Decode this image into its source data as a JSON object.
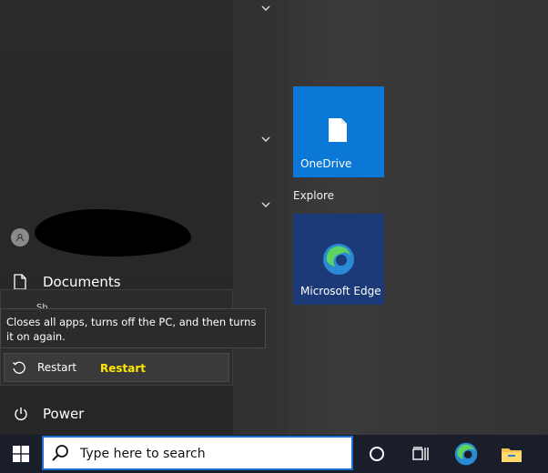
{
  "start_menu": {
    "tiles": {
      "onedrive_label": "OneDrive",
      "group_label": "Explore",
      "edge_label": "Microsoft Edge"
    },
    "user_row": {
      "avatar_icon": "user-icon"
    },
    "documents_label": "Documents",
    "peek_text": "Sh",
    "power_label": "Power",
    "power_flyout": {
      "tooltip": "Closes all apps, turns off the PC, and then turns it on again.",
      "restart_label": "Restart",
      "annotation": "Restart"
    }
  },
  "taskbar": {
    "search_placeholder": "Type here to search"
  },
  "colors": {
    "onedrive_tile": "#0b78d7",
    "edge_tile": "#1c3a78",
    "annotation_text": "#ffe600",
    "search_border": "#1b6fd1"
  }
}
